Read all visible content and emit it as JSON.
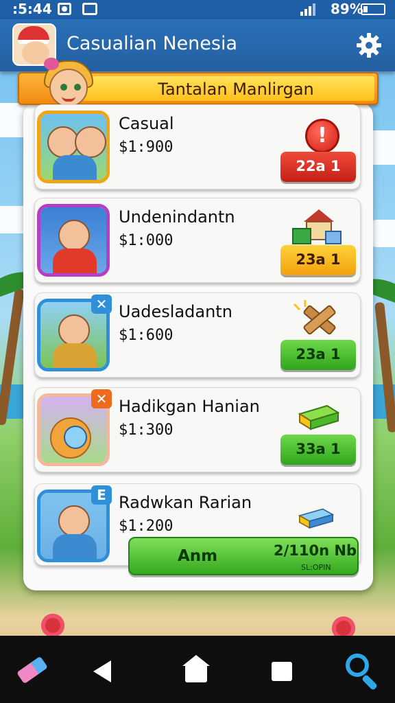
{
  "status_bar": {
    "time": ":5:44",
    "battery": "89%"
  },
  "app_bar": {
    "title": "Casualian Nenesia"
  },
  "banner": {
    "text": "Tantalan Manlirgan"
  },
  "items": [
    {
      "name": "Casual",
      "price": "$1:900",
      "button": "22a 1",
      "button_color": "#d6281b",
      "badge": ""
    },
    {
      "name": "Undenindantn",
      "price": "$1:000",
      "button": "23a 1",
      "button_color": "#f5ae14",
      "badge": ""
    },
    {
      "name": "Uadesladantn",
      "price": "$1:600",
      "button": "23a 1",
      "button_color": "#3bb021",
      "badge": "✕"
    },
    {
      "name": "Hadikgan Hanian",
      "price": "$1:300",
      "button": "33a 1",
      "button_color": "#3bb021",
      "badge": "✕"
    },
    {
      "name": "Radwkan Rarian",
      "price": "$1:200",
      "button": "",
      "button_color": "",
      "badge": "E"
    }
  ],
  "bottom_action": {
    "left_label": "Anm",
    "right_label": "2/110n Nb",
    "sub_label": "SL:OPIN"
  },
  "alert_icon": "!",
  "nav": {
    "icons": [
      "eraser-icon",
      "back-icon",
      "home-icon",
      "recent-apps-icon",
      "search-icon"
    ]
  }
}
